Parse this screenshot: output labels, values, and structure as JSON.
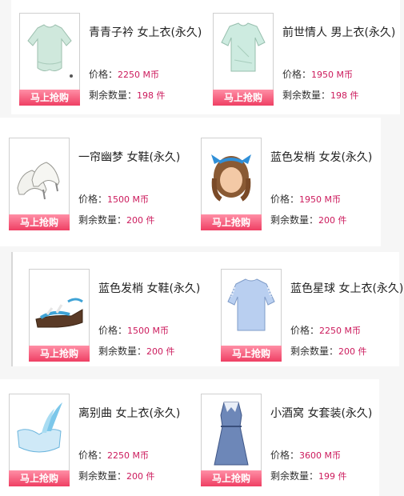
{
  "buy_label": "马上抢购",
  "price_prefix": "价格：",
  "remain_prefix": "剩余数量：",
  "items": [
    {
      "title": "青青子衿 女上衣(永久)",
      "price": "2250 M币",
      "remain": "198 件",
      "icon": "light-green-blouse-icon"
    },
    {
      "title": "前世情人 男上衣(永久)",
      "price": "1950 M币",
      "remain": "198 件",
      "icon": "light-green-shirt-icon"
    },
    {
      "title": "一帘幽梦 女鞋(永久)",
      "price": "1500 M币",
      "remain": "200 件",
      "icon": "white-heels-icon"
    },
    {
      "title": "蓝色发梢 女发(永久)",
      "price": "1950 M币",
      "remain": "200 件",
      "icon": "brown-hair-blue-bow-icon"
    },
    {
      "title": "蓝色发梢 女鞋(永久)",
      "price": "1500 M币",
      "remain": "200 件",
      "icon": "wedge-sandal-icon"
    },
    {
      "title": "蓝色星球 女上衣(永久)",
      "price": "2250 M币",
      "remain": "200 件",
      "icon": "blue-blouse-icon"
    },
    {
      "title": "离别曲 女上衣(永久)",
      "price": "2250 M币",
      "remain": "200 件",
      "icon": "blue-feather-top-icon"
    },
    {
      "title": "小酒窝 女套装(永久)",
      "price": "3600 M币",
      "remain": "199 件",
      "icon": "blue-dress-icon"
    }
  ],
  "colors": {
    "buy_button": "#ef3f63",
    "value_text": "#cc1a5c",
    "border": "#cfcfcf"
  }
}
